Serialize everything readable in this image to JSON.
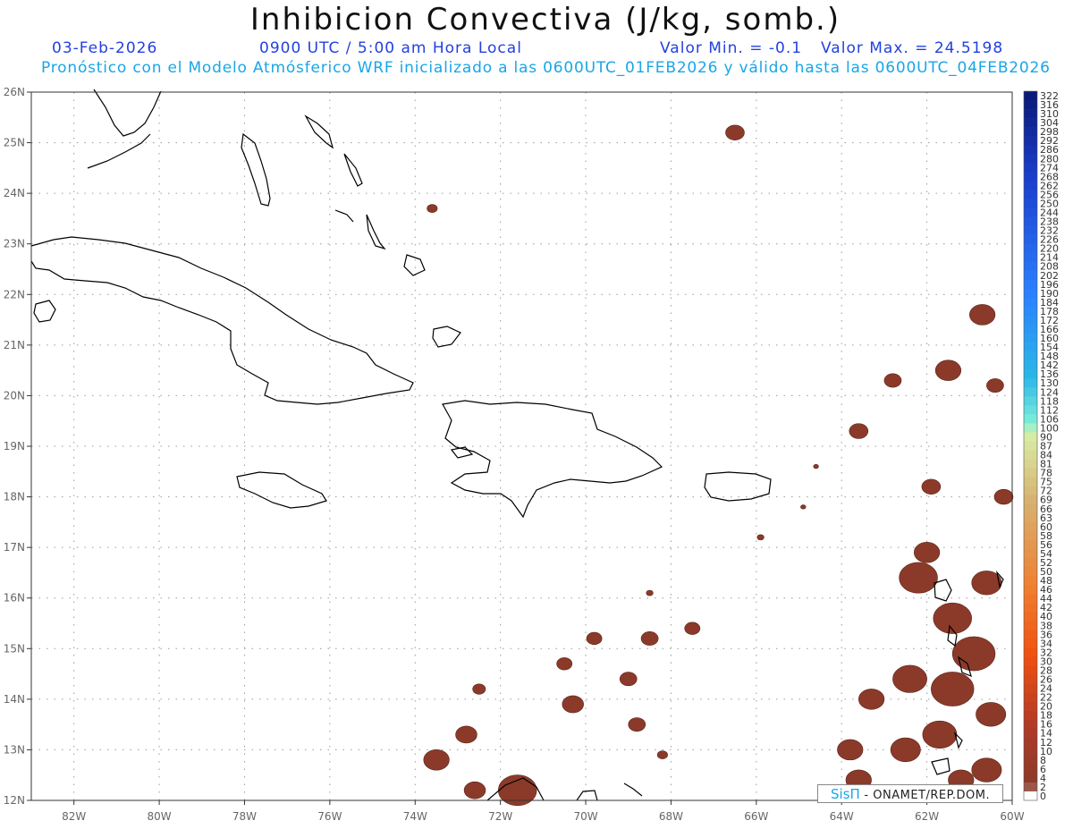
{
  "title": "Inhibicion Convectiva (J/kg, somb.)",
  "header": {
    "date": "03-Feb-2026",
    "time": "0900 UTC / 5:00 am Hora Local",
    "valor_min": "Valor Min. = -0.1",
    "valor_max": "Valor Max. = 24.5198",
    "subtitle": "Pronóstico con el Modelo Atmósferico WRF inicializado a las 0600UTC_01FEB2026 y válido hasta las  0600UTC_04FEB2026"
  },
  "credit": {
    "logo_text": "SisΠ",
    "org": " - ONAMET/REP.DOM."
  },
  "map": {
    "lon_range": [
      -83,
      -60
    ],
    "lat_range": [
      12,
      26
    ],
    "lon_ticks": [
      "82W",
      "80W",
      "78W",
      "76W",
      "74W",
      "72W",
      "70W",
      "68W",
      "66W",
      "64W",
      "62W",
      "60W"
    ],
    "lat_ticks": [
      "26N",
      "25N",
      "24N",
      "23N",
      "22N",
      "21N",
      "20N",
      "19N",
      "18N",
      "17N",
      "16N",
      "15N",
      "14N",
      "13N",
      "12N"
    ],
    "fill_color": "#8b3a2a",
    "coast_color": "#000000",
    "grid_color": "#9a9a9a",
    "cin_areas": [
      {
        "lon": -66.5,
        "lat": 25.2,
        "r": 0.22
      },
      {
        "lon": -73.6,
        "lat": 23.7,
        "r": 0.12
      },
      {
        "lon": -60.7,
        "lat": 21.6,
        "r": 0.3
      },
      {
        "lon": -61.5,
        "lat": 20.5,
        "r": 0.3
      },
      {
        "lon": -62.8,
        "lat": 20.3,
        "r": 0.2
      },
      {
        "lon": -60.4,
        "lat": 20.2,
        "r": 0.2
      },
      {
        "lon": -63.6,
        "lat": 19.3,
        "r": 0.22
      },
      {
        "lon": -61.9,
        "lat": 18.2,
        "r": 0.22
      },
      {
        "lon": -60.2,
        "lat": 18.0,
        "r": 0.22
      },
      {
        "lon": -62.0,
        "lat": 16.9,
        "r": 0.3
      },
      {
        "lon": -60.6,
        "lat": 16.3,
        "r": 0.35
      },
      {
        "lon": -62.2,
        "lat": 16.4,
        "r": 0.45
      },
      {
        "lon": -61.4,
        "lat": 15.6,
        "r": 0.45
      },
      {
        "lon": -60.9,
        "lat": 14.9,
        "r": 0.5
      },
      {
        "lon": -61.4,
        "lat": 14.2,
        "r": 0.5
      },
      {
        "lon": -62.4,
        "lat": 14.4,
        "r": 0.4
      },
      {
        "lon": -63.3,
        "lat": 14.0,
        "r": 0.3
      },
      {
        "lon": -60.5,
        "lat": 13.7,
        "r": 0.35
      },
      {
        "lon": -61.7,
        "lat": 13.3,
        "r": 0.4
      },
      {
        "lon": -62.5,
        "lat": 13.0,
        "r": 0.35
      },
      {
        "lon": -63.8,
        "lat": 13.0,
        "r": 0.3
      },
      {
        "lon": -60.6,
        "lat": 12.6,
        "r": 0.35
      },
      {
        "lon": -61.2,
        "lat": 12.4,
        "r": 0.3
      },
      {
        "lon": -63.6,
        "lat": 12.4,
        "r": 0.3
      },
      {
        "lon": -69.8,
        "lat": 15.2,
        "r": 0.18
      },
      {
        "lon": -68.5,
        "lat": 15.2,
        "r": 0.2
      },
      {
        "lon": -67.5,
        "lat": 15.4,
        "r": 0.18
      },
      {
        "lon": -70.5,
        "lat": 14.7,
        "r": 0.18
      },
      {
        "lon": -69.0,
        "lat": 14.4,
        "r": 0.2
      },
      {
        "lon": -72.5,
        "lat": 14.2,
        "r": 0.15
      },
      {
        "lon": -70.3,
        "lat": 13.9,
        "r": 0.25
      },
      {
        "lon": -68.8,
        "lat": 13.5,
        "r": 0.2
      },
      {
        "lon": -72.8,
        "lat": 13.3,
        "r": 0.25
      },
      {
        "lon": -73.5,
        "lat": 12.8,
        "r": 0.3
      },
      {
        "lon": -71.6,
        "lat": 12.2,
        "r": 0.45
      },
      {
        "lon": -72.6,
        "lat": 12.2,
        "r": 0.25
      },
      {
        "lon": -68.2,
        "lat": 12.9,
        "r": 0.12
      },
      {
        "lon": -68.5,
        "lat": 16.1,
        "r": 0.08
      },
      {
        "lon": -65.9,
        "lat": 17.2,
        "r": 0.08
      },
      {
        "lon": -64.9,
        "lat": 17.8,
        "r": 0.06
      },
      {
        "lon": -64.6,
        "lat": 18.6,
        "r": 0.06
      }
    ],
    "colorbar": {
      "labels": [
        "322",
        "316",
        "310",
        "304",
        "298",
        "292",
        "286",
        "280",
        "274",
        "268",
        "262",
        "256",
        "250",
        "244",
        "238",
        "232",
        "226",
        "220",
        "214",
        "208",
        "202",
        "196",
        "190",
        "184",
        "178",
        "172",
        "166",
        "160",
        "154",
        "148",
        "142",
        "136",
        "130",
        "124",
        "118",
        "112",
        "106",
        "100",
        "90",
        "87",
        "84",
        "81",
        "78",
        "75",
        "72",
        "69",
        "66",
        "63",
        "60",
        "58",
        "56",
        "54",
        "52",
        "50",
        "48",
        "46",
        "44",
        "42",
        "40",
        "38",
        "36",
        "34",
        "32",
        "30",
        "28",
        "26",
        "24",
        "22",
        "20",
        "18",
        "16",
        "14",
        "12",
        "10",
        "8",
        "6",
        "4",
        "2",
        "0"
      ],
      "color_stops": [
        {
          "pos": 0.0,
          "color": "#0a1a7a"
        },
        {
          "pos": 0.12,
          "color": "#1b3fcf"
        },
        {
          "pos": 0.28,
          "color": "#2a7fff"
        },
        {
          "pos": 0.4,
          "color": "#2ab6e8"
        },
        {
          "pos": 0.47,
          "color": "#7ff0d8"
        },
        {
          "pos": 0.48,
          "color": "#d8f0a8"
        },
        {
          "pos": 0.58,
          "color": "#d8b070"
        },
        {
          "pos": 0.7,
          "color": "#f08030"
        },
        {
          "pos": 0.8,
          "color": "#f05010"
        },
        {
          "pos": 0.9,
          "color": "#b03a28"
        },
        {
          "pos": 0.985,
          "color": "#8b3a2a"
        },
        {
          "pos": 1.0,
          "color": "#ffffff"
        }
      ]
    }
  }
}
